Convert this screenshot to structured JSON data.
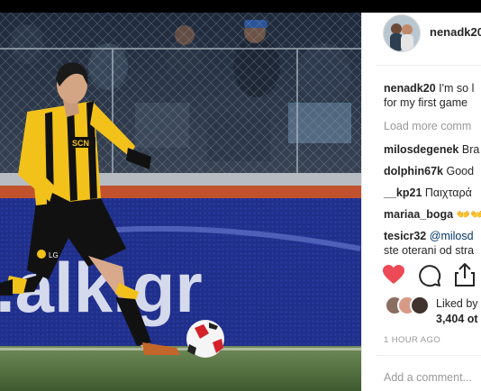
{
  "post": {
    "author": "nenadk20",
    "caption_user": "nenadk20",
    "caption_text": "I'm so l",
    "caption_line2": "for my first game",
    "load_more": "Load more comm",
    "comments": [
      {
        "user": "milosdegenek",
        "text": "Bra"
      },
      {
        "user": "dolphin67k",
        "text": "Good"
      },
      {
        "user": "__kp21",
        "text": "Παιχταρά"
      },
      {
        "user": "mariaa_boga",
        "text": "👐👐"
      },
      {
        "user": "tesicr32",
        "text": "@milosd",
        "text2": "ste oterani od stra"
      }
    ],
    "liked_label": "Liked by",
    "liked_count": "3,404 ot",
    "time": "1 HOUR AGO",
    "add_comment_placeholder": "Add a comment..."
  },
  "photo": {
    "board_text": ".alk.gr",
    "shirt_text": "SCN",
    "colors": {
      "kit_yellow": "#f2c21b",
      "kit_black": "#111111",
      "board_blue": "#1f2f8a",
      "pitch_green": "#54703c",
      "heart_red": "#ed4956"
    }
  },
  "icons": [
    "heart-icon",
    "comment-icon",
    "share-icon"
  ]
}
